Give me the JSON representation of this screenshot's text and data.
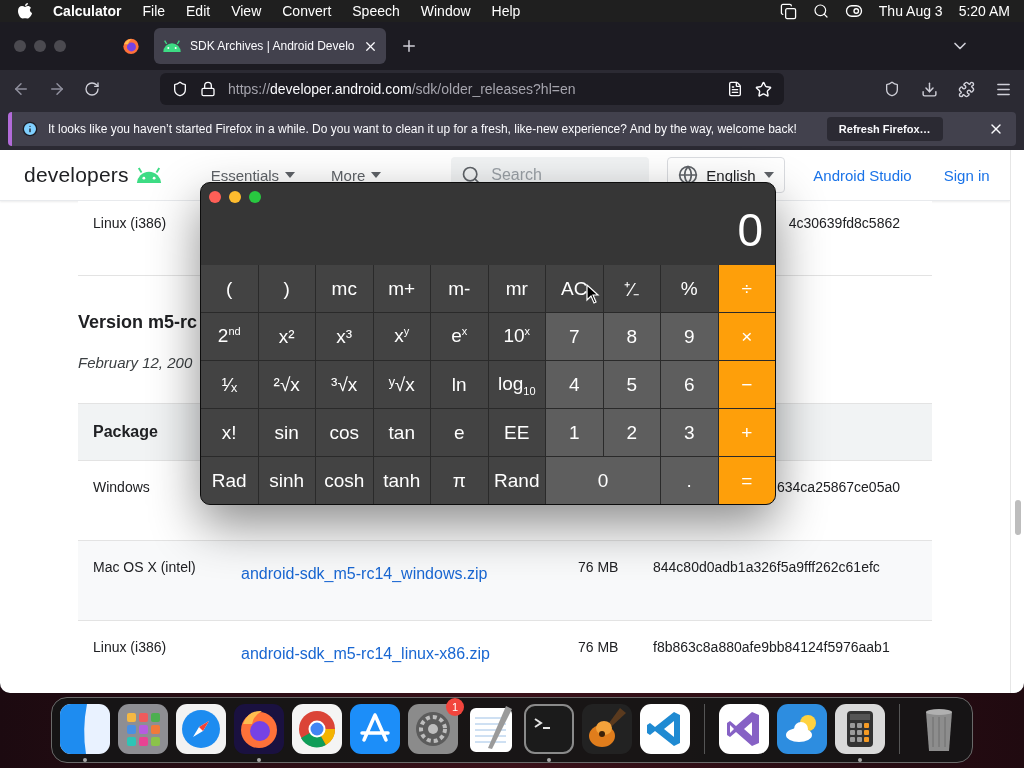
{
  "menubar": {
    "app": "Calculator",
    "menus": [
      "File",
      "Edit",
      "View",
      "Convert",
      "Speech",
      "Window",
      "Help"
    ],
    "date": "Thu Aug 3",
    "time": "5:20 AM"
  },
  "browser": {
    "tabs": [
      {
        "title": "SDK Archives  |  Android Develo",
        "selected": true
      }
    ],
    "url": "https://**developer.android.com**/sdk/older_releases?hl=en"
  },
  "notification": {
    "message": "It looks like you haven’t started Firefox in a while. Do you want to clean it up for a fresh, like-new experience? And by the way, welcome back!",
    "button": "Refresh Firefox…"
  },
  "page": {
    "logo": "developers",
    "nav": [
      "Essentials",
      "More"
    ],
    "search_placeholder": "Search",
    "language": "English",
    "links": [
      "Android Studio",
      "Sign in"
    ],
    "previous_row": {
      "package": "Linux (i386)",
      "checksum": "4c30639fd8c5862",
      "kind": "covered"
    },
    "version": {
      "title": "Version m5-rc",
      "date": "February 12, 200"
    },
    "table": {
      "columns": [
        "Package"
      ],
      "rows": [
        {
          "package": "Windows",
          "checksum": "634ca25867ce05a0",
          "kind": "covered"
        },
        {
          "package": "Mac OS X (intel)",
          "link": "android-sdk_m5-rc14_windows.zip",
          "size": "76 MB",
          "checksum": "844c80d0adb1a326f5a9fff262c61efc",
          "kind": "full"
        },
        {
          "package": "Linux (i386)",
          "link": "android-sdk_m5-rc14_linux-x86.zip",
          "size": "76 MB",
          "checksum": "f8b863c8a880afe9bb84124f5976aab1",
          "kind": "full"
        }
      ]
    }
  },
  "calculator": {
    "display": "0",
    "keys": [
      {
        "label": "(",
        "kind": "function",
        "wide": false
      },
      {
        "label": ")",
        "kind": "function",
        "wide": false
      },
      {
        "label": "mc",
        "kind": "function",
        "wide": false
      },
      {
        "label": "m+",
        "kind": "function",
        "wide": false
      },
      {
        "label": "m-",
        "kind": "function",
        "wide": false
      },
      {
        "label": "mr",
        "kind": "function",
        "wide": false
      },
      {
        "label": "AC",
        "kind": "function",
        "wide": false
      },
      {
        "label": "⁺⁄₋",
        "kind": "function",
        "wide": false
      },
      {
        "label": "%",
        "kind": "function",
        "wide": false
      },
      {
        "label": "÷",
        "kind": "operator",
        "wide": false
      },
      {
        "label": "2$^{nd}$",
        "kind": "function",
        "wide": false
      },
      {
        "label": "x²",
        "kind": "function",
        "wide": false
      },
      {
        "label": "x³",
        "kind": "function",
        "wide": false
      },
      {
        "label": "x$^{y}$",
        "kind": "function",
        "wide": false
      },
      {
        "label": "e$^{x}$",
        "kind": "function",
        "wide": false
      },
      {
        "label": "10$^{x}$",
        "kind": "function",
        "wide": false
      },
      {
        "label": "7",
        "kind": "digit",
        "wide": false
      },
      {
        "label": "8",
        "kind": "digit",
        "wide": false
      },
      {
        "label": "9",
        "kind": "digit",
        "wide": false
      },
      {
        "label": "×",
        "kind": "operator",
        "wide": false
      },
      {
        "label": "¹⁄ₓ",
        "kind": "function",
        "wide": false
      },
      {
        "label": "²√x",
        "kind": "function",
        "wide": false
      },
      {
        "label": "³√x",
        "kind": "function",
        "wide": false
      },
      {
        "label": "ʸ√x",
        "kind": "function",
        "wide": false
      },
      {
        "label": "ln",
        "kind": "function",
        "wide": false
      },
      {
        "label": "log$_{10}$",
        "kind": "function",
        "wide": false
      },
      {
        "label": "4",
        "kind": "digit",
        "wide": false
      },
      {
        "label": "5",
        "kind": "digit",
        "wide": false
      },
      {
        "label": "6",
        "kind": "digit",
        "wide": false
      },
      {
        "label": "−",
        "kind": "operator",
        "wide": false
      },
      {
        "label": "x!",
        "kind": "function",
        "wide": false
      },
      {
        "label": "sin",
        "kind": "function",
        "wide": false
      },
      {
        "label": "cos",
        "kind": "function",
        "wide": false
      },
      {
        "label": "tan",
        "kind": "function",
        "wide": false
      },
      {
        "label": "e",
        "kind": "function",
        "wide": false
      },
      {
        "label": "EE",
        "kind": "function",
        "wide": false
      },
      {
        "label": "1",
        "kind": "digit",
        "wide": false
      },
      {
        "label": "2",
        "kind": "digit",
        "wide": false
      },
      {
        "label": "3",
        "kind": "digit",
        "wide": false
      },
      {
        "label": "+",
        "kind": "operator",
        "wide": false
      },
      {
        "label": "Rad",
        "kind": "function",
        "wide": false
      },
      {
        "label": "sinh",
        "kind": "function",
        "wide": false
      },
      {
        "label": "cosh",
        "kind": "function",
        "wide": false
      },
      {
        "label": "tanh",
        "kind": "function",
        "wide": false
      },
      {
        "label": "π",
        "kind": "function",
        "wide": false
      },
      {
        "label": "Rand",
        "kind": "function",
        "wide": false
      },
      {
        "label": "0",
        "kind": "digit",
        "wide": true
      },
      {
        "label": ".",
        "kind": "digit",
        "wide": false
      },
      {
        "label": "=",
        "kind": "operator",
        "wide": false
      }
    ]
  },
  "dock": {
    "apps": [
      {
        "kind": "finder",
        "running": true
      },
      {
        "kind": "launchpad",
        "running": false
      },
      {
        "kind": "safari",
        "running": false
      },
      {
        "kind": "firefox",
        "running": true
      },
      {
        "kind": "chrome",
        "running": false
      },
      {
        "kind": "appstore",
        "running": false
      },
      {
        "kind": "settings",
        "running": false,
        "badge": "1"
      },
      {
        "kind": "textedit",
        "running": false
      },
      {
        "kind": "terminal",
        "running": true
      },
      {
        "kind": "guitar",
        "running": false
      },
      {
        "kind": "vscode",
        "running": false
      },
      {
        "kind": "separator"
      },
      {
        "kind": "visualstudio",
        "running": false
      },
      {
        "kind": "weather",
        "running": false
      },
      {
        "kind": "calculator",
        "running": true
      },
      {
        "kind": "separator"
      },
      {
        "kind": "trash",
        "running": false
      }
    ]
  }
}
